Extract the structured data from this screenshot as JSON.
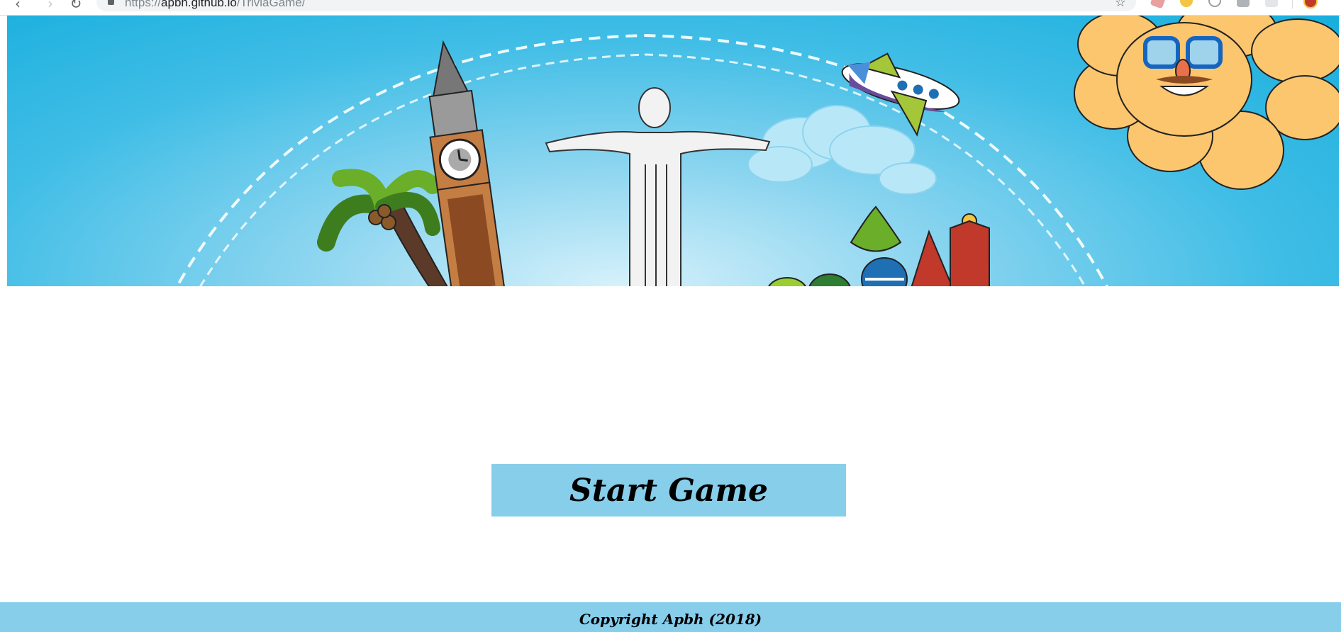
{
  "browser": {
    "url_scheme": "https://",
    "url_host": "apbh.github.io",
    "url_path": "/TriviaGame/"
  },
  "main": {
    "start_button_label": "Start Game"
  },
  "footer": {
    "copyright": "Copyright Apbh (2018)"
  },
  "colors": {
    "button_bg": "#87ceeb",
    "footer_bg": "#87ceeb",
    "banner_sky": "#17aedd"
  }
}
